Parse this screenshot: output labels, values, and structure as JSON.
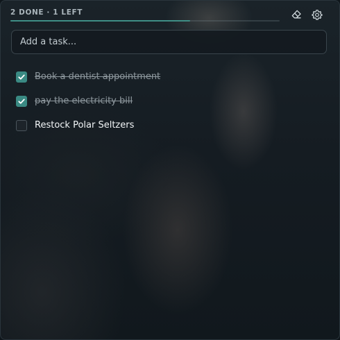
{
  "header": {
    "status_text": "2 DONE · 1 LEFT",
    "progress_fraction": 0.667
  },
  "toolbar": {
    "clear_icon": "eraser-icon",
    "settings_icon": "gear-icon"
  },
  "input": {
    "placeholder": "Add a task...",
    "value": ""
  },
  "tasks": [
    {
      "label": "Book a dentist appointment",
      "done": true
    },
    {
      "label": "pay the electricity bill",
      "done": true
    },
    {
      "label": "Restock Polar Seltzers",
      "done": false
    }
  ],
  "colors": {
    "accent": "#3a8a83",
    "progress": "#3f8f86"
  }
}
